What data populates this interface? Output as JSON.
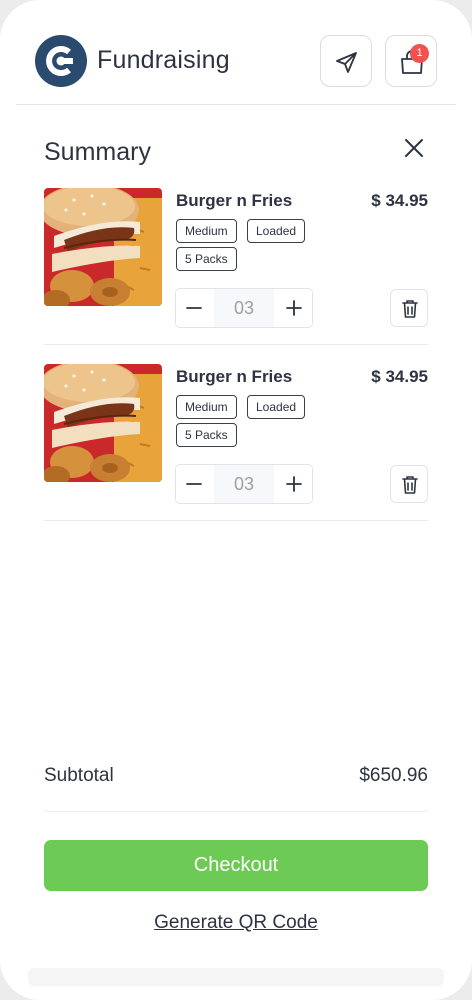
{
  "header": {
    "brand": "Fundraising",
    "send_icon": "send-icon",
    "bag_icon": "shopping-bag-icon",
    "cart_count": "1"
  },
  "summary": {
    "title": "Summary",
    "close_icon": "close-icon"
  },
  "items": [
    {
      "name": "Burger n Fries",
      "price": "$ 34.95",
      "tags": [
        "Medium",
        "Loaded",
        "5 Packs"
      ],
      "quantity": "03",
      "image_icon": "burger-fries-photo"
    },
    {
      "name": "Burger n Fries",
      "price": "$ 34.95",
      "tags": [
        "Medium",
        "Loaded",
        "5 Packs"
      ],
      "quantity": "03",
      "image_icon": "burger-fries-photo"
    }
  ],
  "footer": {
    "subtotal_label": "Subtotal",
    "subtotal_value": "$650.96",
    "checkout_label": "Checkout",
    "qr_label": "Generate QR Code"
  },
  "colors": {
    "brand": "#2a4a6e",
    "accent_green": "#6cca55",
    "badge_red": "#f0534f",
    "text": "#2d3340"
  }
}
